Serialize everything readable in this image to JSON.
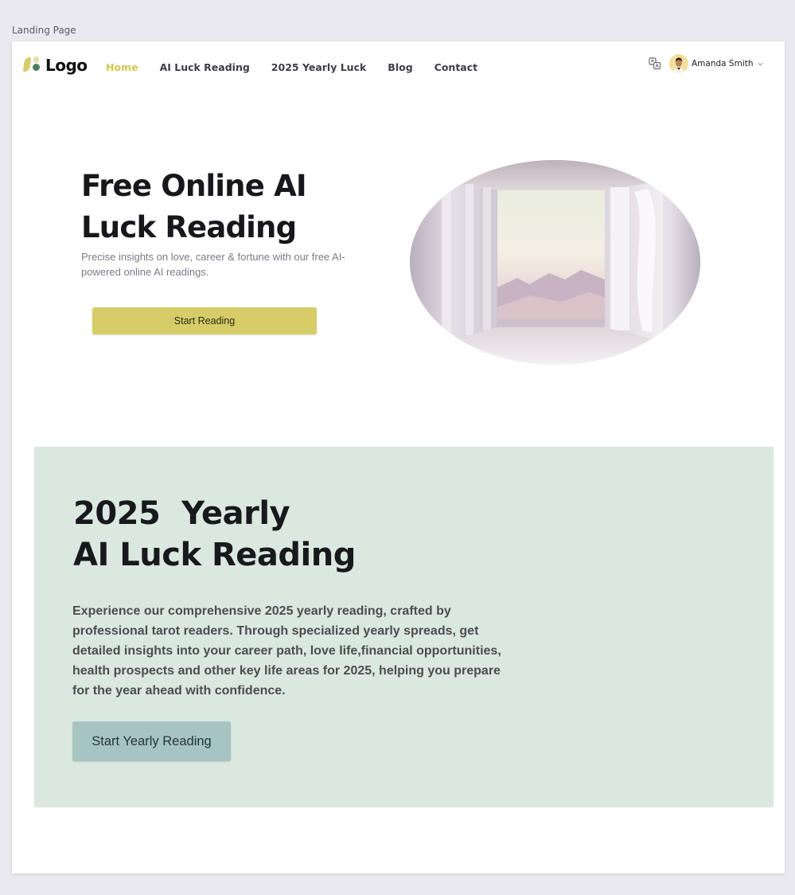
{
  "frame": {
    "label": "Landing Page"
  },
  "header": {
    "logo_text": "Logo",
    "nav": [
      {
        "label": "Home",
        "active": true
      },
      {
        "label": "AI Luck Reading",
        "active": false
      },
      {
        "label": "2025 Yearly Luck",
        "active": false
      },
      {
        "label": "Blog",
        "active": false
      },
      {
        "label": "Contact",
        "active": false
      }
    ],
    "translate_icon": "translate-icon",
    "user": {
      "name": "Amanda Smith"
    }
  },
  "hero": {
    "title": "Free Online AI Luck Reading",
    "subtitle": "Precise insights on love, career & fortune with our free AI-powered online AI readings.",
    "button_label": "Start Reading"
  },
  "yearly": {
    "title_line1": "2025  Yearly",
    "title_line2": "AI Luck Reading",
    "description": "Experience our comprehensive 2025  yearly reading, crafted by professional tarot readers. Through specialized yearly spreads, get detailed insights into your career path, love life,financial opportunities, health prospects and other key life areas for 2025, helping you prepare for the year ahead with confidence.",
    "button_label": "Start Yearly Reading"
  },
  "colors": {
    "page_bg": "#ebe9f0",
    "accent_yellow": "#d6cd68",
    "nav_active": "#d5c84e",
    "yearly_bg": "#dbe8e0",
    "yearly_button": "#a6c5c2"
  }
}
